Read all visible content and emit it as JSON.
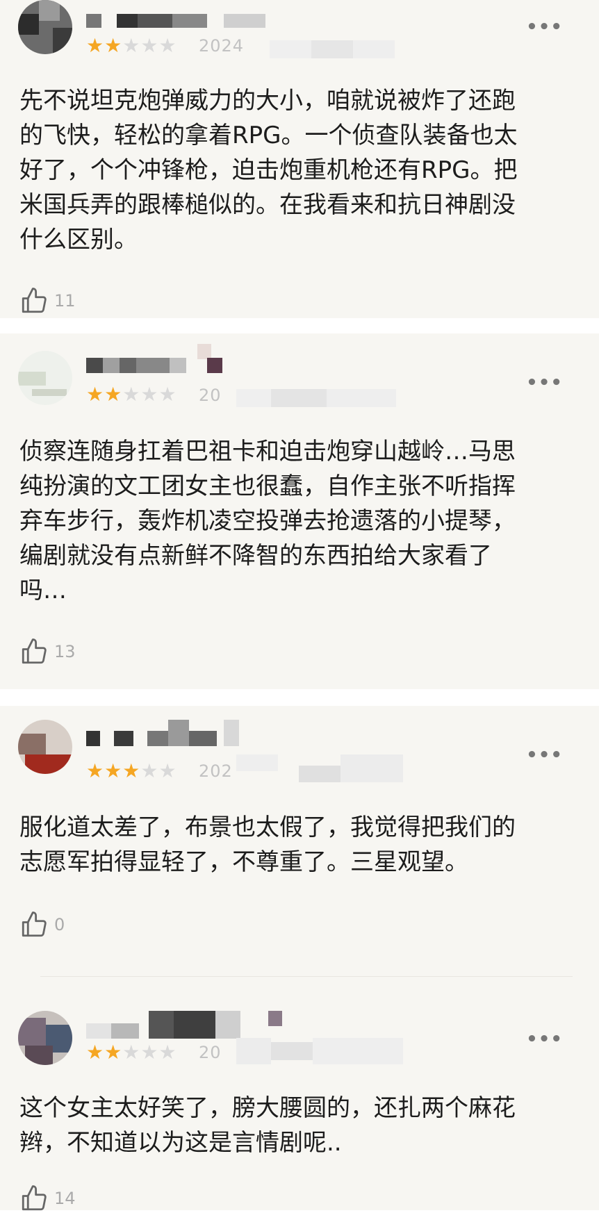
{
  "comments": [
    {
      "date": "2024",
      "rating": 2,
      "text": "先不说坦克炮弹威力的大小，咱就说被炸了还跑\n的飞快，轻松的拿着RPG。一个侦查队装备也太\n好了，个个冲锋枪，迫击炮重机枪还有RPG。把\n米国兵弄的跟棒槌似的。在我看来和抗日神剧没\n什么区别。",
      "likes": "11",
      "more": "•••",
      "like_icon": "thumbs-up-icon"
    },
    {
      "date": "20",
      "rating": 2,
      "text": "侦察连随身扛着巴祖卡和迫击炮穿山越岭…马思\n纯扮演的文工团女主也很蠢，自作主张不听指挥\n弃车步行，轰炸机凌空投弹去抢遗落的小提琴，\n编剧就没有点新鲜不降智的东西拍给大家看了\n吗…",
      "likes": "13",
      "more": "•••",
      "like_icon": "thumbs-up-icon"
    },
    {
      "date": "202",
      "rating": 3,
      "text": "服化道太差了，布景也太假了，我觉得把我们的\n志愿军拍得显轻了，不尊重了。三星观望。",
      "likes": "0",
      "more": "•••",
      "like_icon": "thumbs-up-icon"
    },
    {
      "date": "20",
      "rating": 2,
      "text": "这个女主太好笑了，膀大腰圆的，还扎两个麻花\n辫，不知道以为这是言情剧呢..",
      "likes": "14",
      "more": "•••",
      "like_icon": "thumbs-up-icon"
    }
  ],
  "colors": {
    "star_on": "#f5a623",
    "star_off": "#d9d9d9",
    "card_bg": "#f7f6f2"
  }
}
